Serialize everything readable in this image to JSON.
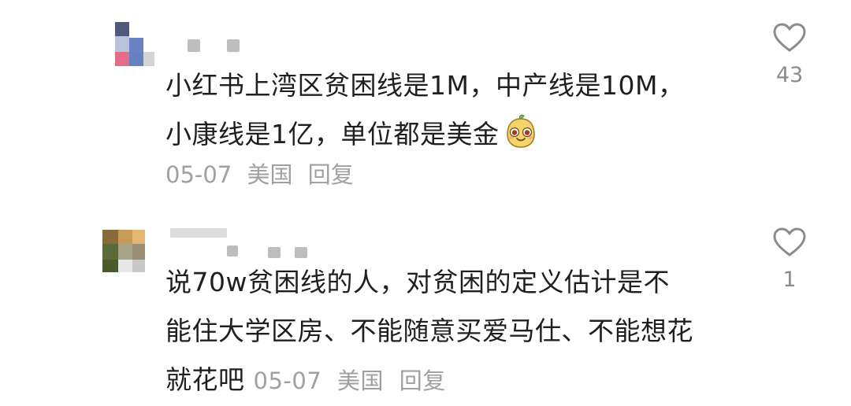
{
  "comments": [
    {
      "text_lines": [
        "小红书上湾区贫困线是1M，中产线是10M，",
        "小康线是1亿，单位都是美金"
      ],
      "emoji": "smiling-mango-face-icon",
      "date": "05-07",
      "location": "美国",
      "reply_label": "回复",
      "likes": "43"
    },
    {
      "text_lines": [
        "说70w贫困线的人，对贫困的定义估计是不",
        "能住大学区房、不能随意买爱马仕、不能想花",
        "就花吧"
      ],
      "date": "05-07",
      "location": "美国",
      "reply_label": "回复",
      "likes": "1"
    }
  ],
  "colors": {
    "text": "#1f1f1f",
    "meta": "#a0a0a0",
    "heart_outline": "#8c8c8c"
  }
}
